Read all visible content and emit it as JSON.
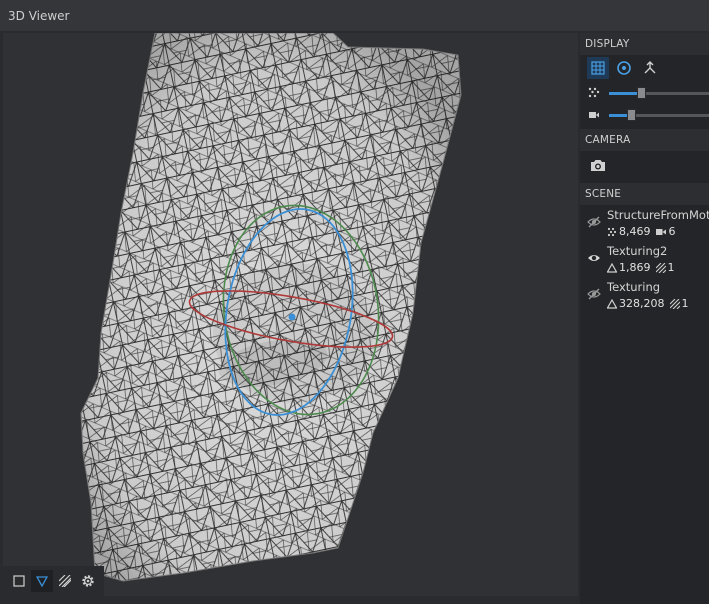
{
  "window": {
    "title": "3D Viewer"
  },
  "viewport_toolbar": {
    "buttons": [
      {
        "icon": "square-icon",
        "active": false
      },
      {
        "icon": "triangle-down-icon",
        "active": true
      },
      {
        "icon": "hatch-icon",
        "active": false
      },
      {
        "icon": "gear-icon",
        "active": false
      }
    ]
  },
  "panel": {
    "display": {
      "header": "DISPLAY",
      "buttons": [
        {
          "icon": "grid-icon",
          "active": true
        },
        {
          "icon": "target-icon",
          "active": false
        },
        {
          "icon": "axis-icon",
          "active": false
        }
      ],
      "sliders": [
        {
          "icon": "points-icon",
          "value": 0.32
        },
        {
          "icon": "camera-icon",
          "value": 0.22
        }
      ]
    },
    "camera": {
      "header": "CAMERA",
      "button_icon": "camera-snapshot-icon"
    },
    "scene": {
      "header": "SCENE",
      "items": [
        {
          "name": "StructureFromMotion",
          "visible": false,
          "stat1": "8,469",
          "stat1_icon": "points-icon",
          "stat2": "6",
          "stat2_icon": "camera-icon"
        },
        {
          "name": "Texturing2",
          "visible": true,
          "stat1": "1,869",
          "stat1_icon": "triangle-icon",
          "stat2": "1",
          "stat2_icon": "texture-icon"
        },
        {
          "name": "Texturing",
          "visible": false,
          "stat1": "328,208",
          "stat1_icon": "triangle-icon",
          "stat2": "1",
          "stat2_icon": "texture-icon"
        }
      ]
    }
  },
  "colors": {
    "accent": "#3a8fd6",
    "gizmo_red": "#b03a3a",
    "gizmo_green": "#4d8a4d",
    "gizmo_blue": "#3a8fd6",
    "mesh_fill": "#d9d9d9",
    "mesh_edges": "#2b2b2b"
  }
}
